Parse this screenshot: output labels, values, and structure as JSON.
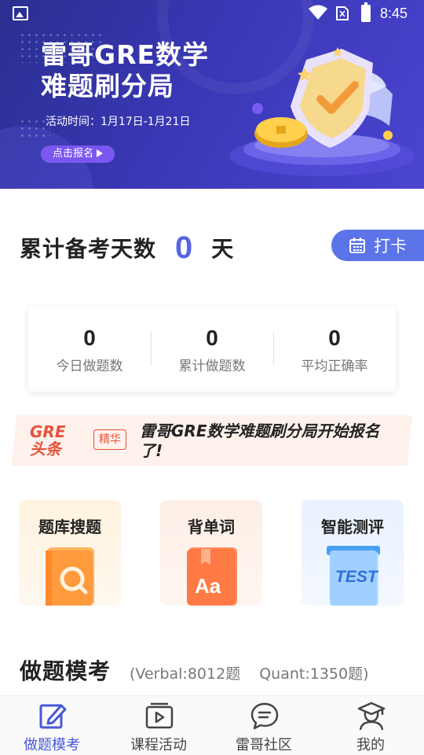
{
  "status_bar": {
    "time": "8:45"
  },
  "banner": {
    "title_line1": "雷哥GRE数学",
    "title_line2": "难题刷分局",
    "date": "活动时间：1月17日-1月21日",
    "button_label": "点击报名"
  },
  "prep_days": {
    "label": "累计备考天数",
    "value": "0",
    "unit": "天"
  },
  "checkin_button": {
    "label": "打卡"
  },
  "stats": [
    {
      "value": "0",
      "label": "今日做题数"
    },
    {
      "value": "0",
      "label": "累计做题数"
    },
    {
      "value": "0",
      "label": "平均正确率"
    }
  ],
  "headline": {
    "logo_line1": "GRE",
    "logo_line2": "头条",
    "tag": "精华",
    "text": "雷哥GRE数学难题刷分局开始报名了!"
  },
  "features": [
    {
      "label": "题库搜题",
      "icon": "search-book-icon"
    },
    {
      "label": "背单词",
      "icon": "vocab-book-icon"
    },
    {
      "label": "智能测评",
      "icon": "test-icon"
    }
  ],
  "mock_section": {
    "title": "做题模考",
    "verbal": "(Verbal:8012题",
    "quant": "Quant:1350题)"
  },
  "bottom_nav": [
    {
      "label": "做题模考",
      "icon": "edit-icon",
      "active": true
    },
    {
      "label": "课程活动",
      "icon": "video-icon",
      "active": false
    },
    {
      "label": "雷哥社区",
      "icon": "chat-icon",
      "active": false
    },
    {
      "label": "我的",
      "icon": "profile-icon",
      "active": false
    }
  ],
  "colors": {
    "accent": "#5564e8",
    "nav_active": "#4658d8",
    "headline_red": "#e5533a"
  }
}
